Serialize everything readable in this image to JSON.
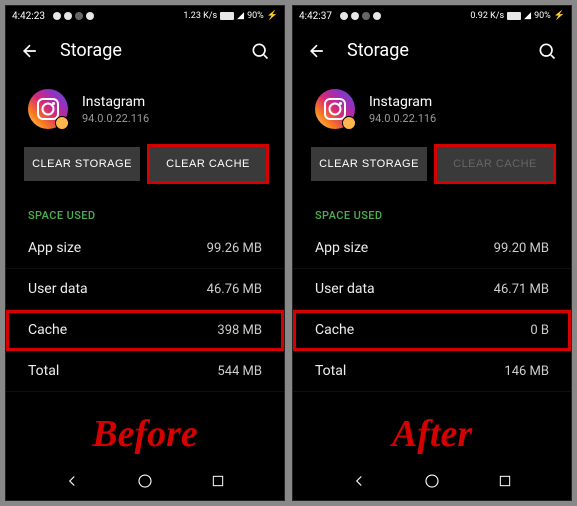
{
  "screens": [
    {
      "status": {
        "time": "4:42:23",
        "net_speed": "1.23 K/s",
        "battery": "90%"
      },
      "header": {
        "title": "Storage"
      },
      "app": {
        "name": "Instagram",
        "version": "94.0.0.22.116"
      },
      "buttons": {
        "clear_storage": "CLEAR STORAGE",
        "clear_cache": "CLEAR CACHE",
        "cache_disabled": false,
        "cache_highlight": true
      },
      "section_label": "SPACE USED",
      "stats": {
        "app_size_label": "App size",
        "app_size": "99.26 MB",
        "user_data_label": "User data",
        "user_data": "46.76 MB",
        "cache_label": "Cache",
        "cache": "398 MB",
        "cache_highlight": true,
        "total_label": "Total",
        "total": "544 MB"
      },
      "caption": "Before"
    },
    {
      "status": {
        "time": "4:42:37",
        "net_speed": "0.92 K/s",
        "battery": "90%"
      },
      "header": {
        "title": "Storage"
      },
      "app": {
        "name": "Instagram",
        "version": "94.0.0.22.116"
      },
      "buttons": {
        "clear_storage": "CLEAR STORAGE",
        "clear_cache": "CLEAR CACHE",
        "cache_disabled": true,
        "cache_highlight": true
      },
      "section_label": "SPACE USED",
      "stats": {
        "app_size_label": "App size",
        "app_size": "99.20 MB",
        "user_data_label": "User data",
        "user_data": "46.71 MB",
        "cache_label": "Cache",
        "cache": "0 B",
        "cache_highlight": true,
        "total_label": "Total",
        "total": "146 MB"
      },
      "caption": "After"
    }
  ]
}
